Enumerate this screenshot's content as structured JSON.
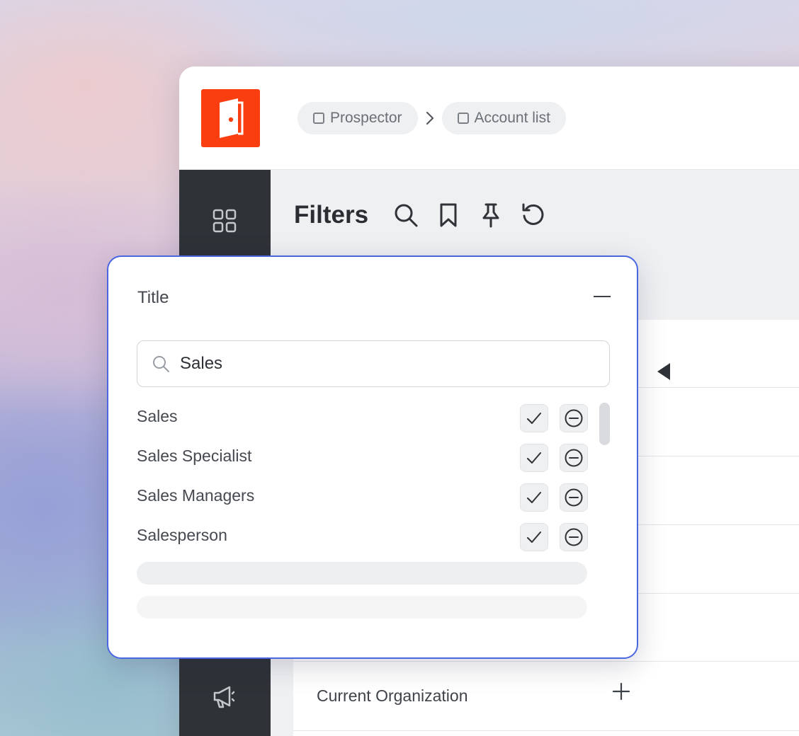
{
  "breadcrumbs": [
    {
      "label": "Prospector"
    },
    {
      "label": "Account list"
    }
  ],
  "filters": {
    "title": "Filters"
  },
  "popover": {
    "title": "Title",
    "search_value": "Sales",
    "options": [
      {
        "label": "Sales"
      },
      {
        "label": "Sales Specialist"
      },
      {
        "label": "Sales Managers"
      },
      {
        "label": "Salesperson"
      }
    ]
  },
  "panel": {
    "current_org_label": "Current Organization"
  },
  "colors": {
    "brand": "#fa3e10",
    "sidebar": "#2f3338",
    "popover_border": "#4a67e3"
  }
}
